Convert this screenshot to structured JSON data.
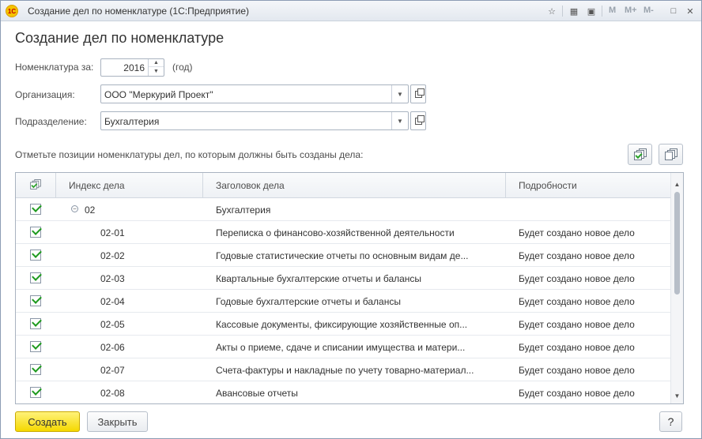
{
  "window": {
    "title": "Создание дел по номенклатуре  (1С:Предприятие)",
    "logo_text": "1С",
    "toolbar": {
      "m_label": "M",
      "m_plus_label": "M+",
      "m_minus_label": "M-"
    }
  },
  "form": {
    "title": "Создание дел по номенклатуре",
    "year_label": "Номенклатура за:",
    "year_value": "2016",
    "year_suffix": "(год)",
    "organization_label": "Организация:",
    "organization_value": "ООО \"Меркурий Проект\"",
    "department_label": "Подразделение:",
    "department_value": "Бухгалтерия",
    "section_label": "Отметьте позиции номенклатуры дел, по которым должны быть созданы дела:"
  },
  "table": {
    "columns": [
      "Индекс дела",
      "Заголовок дела",
      "Подробности"
    ],
    "rows": [
      {
        "index": "02",
        "title": "Бухгалтерия",
        "details": ""
      },
      {
        "index": "02-01",
        "title": "Переписка о финансово-хозяйственной деятельности",
        "details": "Будет создано новое дело"
      },
      {
        "index": "02-02",
        "title": "Годовые статистические отчеты по основным видам де...",
        "details": "Будет создано новое дело"
      },
      {
        "index": "02-03",
        "title": "Квартальные бухгалтерские отчеты и балансы",
        "details": "Будет создано новое дело"
      },
      {
        "index": "02-04",
        "title": "Годовые бухгалтерские отчеты и балансы",
        "details": "Будет создано новое дело"
      },
      {
        "index": "02-05",
        "title": "Кассовые документы, фиксирующие хозяйственные оп...",
        "details": "Будет создано новое дело"
      },
      {
        "index": "02-06",
        "title": "Акты о приеме, сдаче и списании имущества и матери...",
        "details": "Будет создано новое дело"
      },
      {
        "index": "02-07",
        "title": "Счета-фактуры и накладные по учету товарно-материал...",
        "details": "Будет создано новое дело"
      },
      {
        "index": "02-08",
        "title": "Авансовые отчеты",
        "details": "Будет создано новое дело"
      }
    ]
  },
  "buttons": {
    "create": "Создать",
    "close": "Закрыть",
    "help": "?"
  },
  "colors": {
    "primary_button": "#f5d800",
    "checkmark": "#1e9a1e",
    "border": "#a9b3c0"
  }
}
